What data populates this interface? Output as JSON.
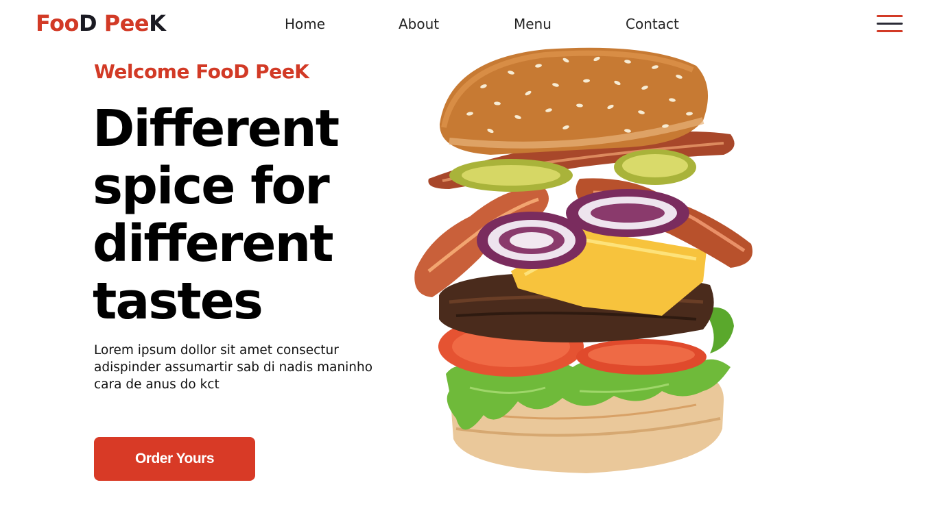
{
  "brand": {
    "part1": "Foo",
    "part2": "D",
    "part3": " Pee",
    "part4": "K"
  },
  "nav": {
    "home": "Home",
    "about": "About",
    "menu": "Menu",
    "contact": "Contact"
  },
  "menu_icon": "hamburger-icon",
  "hero": {
    "welcome": "Welcome FooD PeeK",
    "headline_line1": "Different",
    "headline_line2": "spice for",
    "headline_line3": "different",
    "headline_line4": "tastes",
    "description": "Lorem ipsum dollor sit amet consectur adispinder assumartir sab di nadis maninho cara de anus do kct",
    "cta_label": "Order Yours",
    "image": "burger-image"
  },
  "colors": {
    "accent": "#d83a26",
    "text": "#000000",
    "background": "#ffffff"
  }
}
